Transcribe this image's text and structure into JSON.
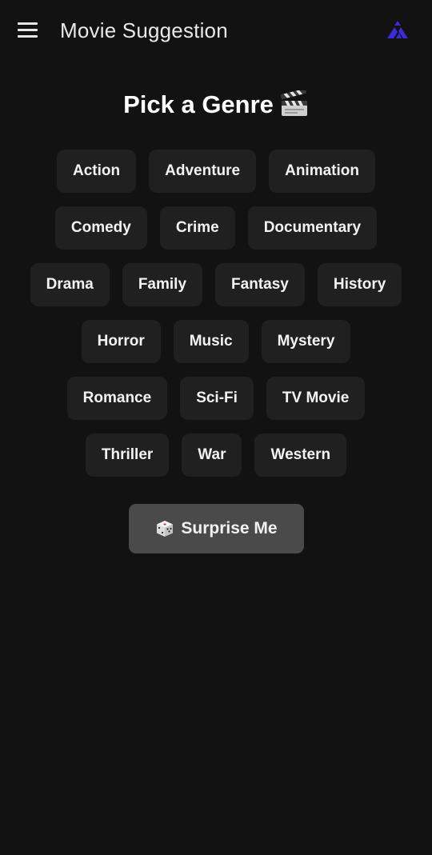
{
  "app": {
    "title": "Movie Suggestion",
    "accent_color": "#3b2bd9"
  },
  "page": {
    "heading": "Pick a Genre",
    "heading_icon": "clapperboard-icon"
  },
  "genres": {
    "rows": [
      [
        "Action",
        "Adventure",
        "Animation"
      ],
      [
        "Comedy",
        "Crime",
        "Documentary"
      ],
      [
        "Drama",
        "Family",
        "Fantasy",
        "History"
      ],
      [
        "Horror",
        "Music",
        "Mystery"
      ],
      [
        "Romance",
        "Sci-Fi",
        "TV Movie"
      ],
      [
        "Thriller",
        "War",
        "Western"
      ]
    ]
  },
  "surprise": {
    "label": "Surprise Me",
    "icon": "dice-icon"
  }
}
